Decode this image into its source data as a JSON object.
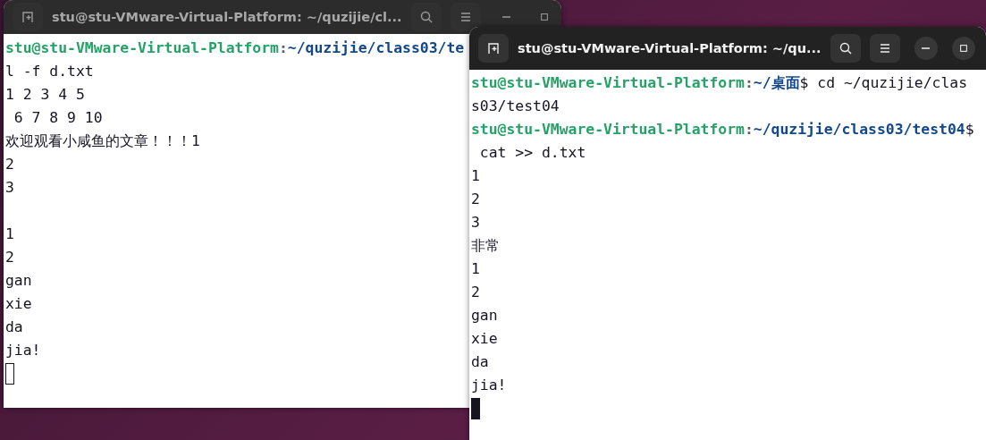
{
  "windows": [
    {
      "title": "stu@stu-VMware-Virtual-Platform: ~/quzijie/cl...",
      "focused": false,
      "lines": [
        {
          "kind": "text",
          "segments": [
            {
              "kind": "user",
              "text": "stu@stu-VMware-Virtual-Platform"
            },
            {
              "kind": "sep",
              "text": ":"
            },
            {
              "kind": "path",
              "text": "~/quzijie/class03/te"
            }
          ]
        },
        {
          "kind": "text",
          "segments": [
            {
              "kind": "plain",
              "text": "l -f d.txt"
            }
          ]
        },
        {
          "kind": "text",
          "segments": [
            {
              "kind": "plain",
              "text": "1 2 3 4 5"
            }
          ]
        },
        {
          "kind": "text",
          "segments": [
            {
              "kind": "plain",
              "text": " 6 7 8 9 10"
            }
          ]
        },
        {
          "kind": "text",
          "segments": [
            {
              "kind": "plain",
              "text": "欢迎观看小咸鱼的文章！！！1"
            }
          ]
        },
        {
          "kind": "text",
          "segments": [
            {
              "kind": "plain",
              "text": "2"
            }
          ]
        },
        {
          "kind": "text",
          "segments": [
            {
              "kind": "plain",
              "text": "3"
            }
          ]
        },
        {
          "kind": "blank"
        },
        {
          "kind": "text",
          "segments": [
            {
              "kind": "plain",
              "text": "1"
            }
          ]
        },
        {
          "kind": "text",
          "segments": [
            {
              "kind": "plain",
              "text": "2"
            }
          ]
        },
        {
          "kind": "text",
          "segments": [
            {
              "kind": "plain",
              "text": "gan"
            }
          ]
        },
        {
          "kind": "text",
          "segments": [
            {
              "kind": "plain",
              "text": "xie"
            }
          ]
        },
        {
          "kind": "text",
          "segments": [
            {
              "kind": "plain",
              "text": "da"
            }
          ]
        },
        {
          "kind": "text",
          "segments": [
            {
              "kind": "plain",
              "text": "jia!"
            }
          ]
        },
        {
          "kind": "cursor"
        }
      ]
    },
    {
      "title": "stu@stu-VMware-Virtual-Platform: ~/qu...",
      "focused": true,
      "lines": [
        {
          "kind": "text",
          "segments": [
            {
              "kind": "user",
              "text": "stu@stu-VMware-Virtual-Platform"
            },
            {
              "kind": "sep",
              "text": ":"
            },
            {
              "kind": "path",
              "text": "~/桌面"
            },
            {
              "kind": "plain",
              "text": "$ cd ~/quzijie/clas"
            }
          ]
        },
        {
          "kind": "text",
          "segments": [
            {
              "kind": "plain",
              "text": "s03/test04"
            }
          ]
        },
        {
          "kind": "text",
          "segments": [
            {
              "kind": "user",
              "text": "stu@stu-VMware-Virtual-Platform"
            },
            {
              "kind": "sep",
              "text": ":"
            },
            {
              "kind": "path",
              "text": "~/quzijie/class03/test04"
            },
            {
              "kind": "plain",
              "text": "$"
            }
          ]
        },
        {
          "kind": "text",
          "segments": [
            {
              "kind": "plain",
              "text": " cat >> d.txt"
            }
          ]
        },
        {
          "kind": "text",
          "segments": [
            {
              "kind": "plain",
              "text": "1"
            }
          ]
        },
        {
          "kind": "text",
          "segments": [
            {
              "kind": "plain",
              "text": "2"
            }
          ]
        },
        {
          "kind": "text",
          "segments": [
            {
              "kind": "plain",
              "text": "3"
            }
          ]
        },
        {
          "kind": "text",
          "segments": [
            {
              "kind": "plain",
              "text": "非常"
            }
          ]
        },
        {
          "kind": "text",
          "segments": [
            {
              "kind": "plain",
              "text": "1"
            }
          ]
        },
        {
          "kind": "text",
          "segments": [
            {
              "kind": "plain",
              "text": "2"
            }
          ]
        },
        {
          "kind": "text",
          "segments": [
            {
              "kind": "plain",
              "text": "gan"
            }
          ]
        },
        {
          "kind": "text",
          "segments": [
            {
              "kind": "plain",
              "text": "xie"
            }
          ]
        },
        {
          "kind": "text",
          "segments": [
            {
              "kind": "plain",
              "text": "da"
            }
          ]
        },
        {
          "kind": "text",
          "segments": [
            {
              "kind": "plain",
              "text": "jia!"
            }
          ]
        },
        {
          "kind": "cursor"
        }
      ]
    }
  ]
}
